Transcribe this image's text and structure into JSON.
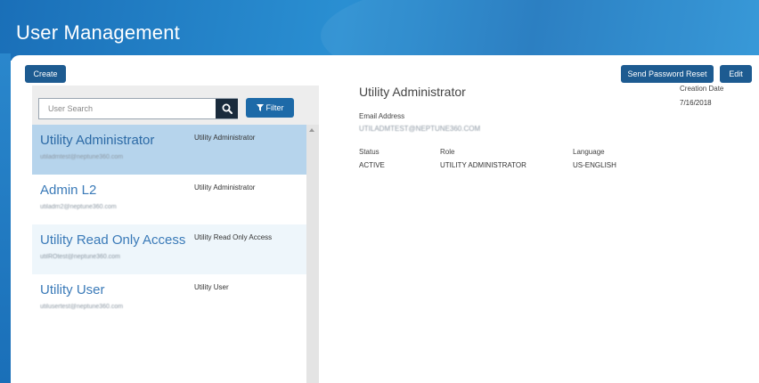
{
  "header": {
    "title": "User Management"
  },
  "toolbar": {
    "create_label": "Create",
    "send_password_reset_label": "Send Password Reset",
    "edit_label": "Edit"
  },
  "search": {
    "placeholder": "User Search",
    "filter_label": "Filter"
  },
  "users": [
    {
      "name": "Utility Administrator",
      "email": "utiladmtest@neptune360.com",
      "role": "Utility Administrator"
    },
    {
      "name": "Admin L2",
      "email": "utiladm2@neptune360.com",
      "role": "Utility Administrator"
    },
    {
      "name": "Utility Read Only Access",
      "email": "utilROtest@neptune360.com",
      "role": "Utility Read Only Access"
    },
    {
      "name": "Utility User",
      "email": "utilusertest@neptune360.com",
      "role": "Utility User"
    }
  ],
  "selected_user_index": 0,
  "detail": {
    "title": "Utility Administrator",
    "creation_date_label": "Creation Date",
    "creation_date": "7/16/2018",
    "email_label": "Email Address",
    "email": "UTILADMTEST@NEPTUNE360.COM",
    "status_label": "Status",
    "status": "ACTIVE",
    "role_label": "Role",
    "role": "UTILITY ADMINISTRATOR",
    "language_label": "Language",
    "language": "US-ENGLISH"
  },
  "colors": {
    "header_blue": "#1f78bf",
    "button_navy": "#1d5b91",
    "selected_row": "#b6d4ec",
    "link_blue": "#3a7ab8"
  },
  "icons": {
    "search": "search-icon",
    "filter": "filter-icon"
  }
}
